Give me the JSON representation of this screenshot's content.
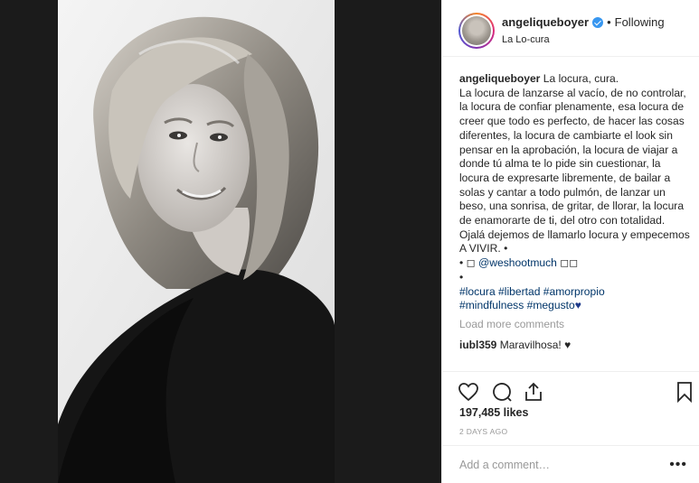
{
  "header": {
    "username": "angeliqueboyer",
    "dot": "•",
    "follow_status": "Following",
    "location": "La Lo-cura"
  },
  "caption": {
    "username": "angeliqueboyer",
    "text": "La locura, cura.\nLa locura de lanzarse al vacío, de no controlar, la locura de confiar plenamente, esa locura de creer que todo es perfecto, de hacer las cosas diferentes, la locura de cambiarte el look sin pensar en la aprobación, la locura de viajar a donde tú alma te lo pide sin cuestionar, la locura de expresarte libremente, de bailar a solas y cantar a todo pulmón, de lanzar un beso, una sonrisa, de gritar, de llorar, la locura de enamorarte de ti, del otro con totalidad. Ojalá dejemos de llamarlo locura y empecemos A VIVIR. •",
    "credit_prefix": "• ◻ ",
    "credit_handle": "@weshootmuch",
    "credit_suffix": " ◻◻",
    "bullet": "•",
    "hashtags_line1": "#locura #libertad #amorpropio",
    "hashtags_line2": "#mindfulness #megusto",
    "heart": "♥"
  },
  "load_more": "Load more comments",
  "comment": {
    "username": "iubl359",
    "text": "Maravilhosa! ♥"
  },
  "actions": {
    "like_icon": "heart-outline-icon",
    "comment_icon": "comment-bubble-icon",
    "share_icon": "share-icon",
    "save_icon": "bookmark-icon"
  },
  "likes": "197,485 likes",
  "timestamp": "2 DAYS AGO",
  "add_comment_placeholder": "Add a comment…",
  "more_options": "•••",
  "colors": {
    "link": "#003569",
    "verified": "#3897f0",
    "muted": "#999999"
  }
}
